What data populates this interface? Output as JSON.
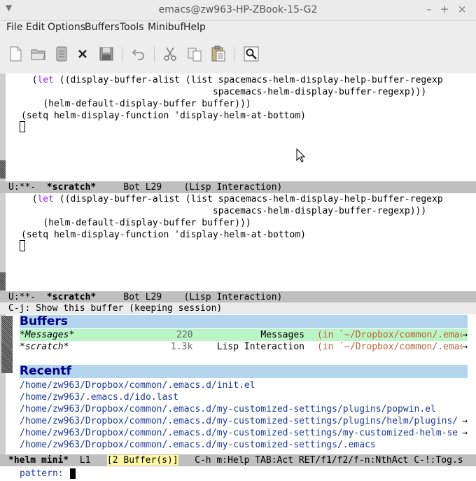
{
  "window": {
    "title": "emacs@zw963-HP-ZBook-15-G2",
    "buttons": [
      "–",
      "+",
      "×"
    ]
  },
  "menubar": {
    "items": [
      "File",
      "Edit",
      "Options",
      "Buffers",
      "Tools",
      "Minibuf",
      "Help"
    ]
  },
  "toolbar": {
    "icons": [
      "new-file-icon",
      "open-folder-icon",
      "dired-icon",
      "close-icon",
      "save-icon",
      "undo-icon",
      "cut-icon",
      "copy-icon",
      "paste-icon",
      "search-icon"
    ]
  },
  "upper_window": {
    "lines": [
      {
        "pre": "  (",
        "kw": "let",
        "post": " ((display-buffer-alist (list spacemacs-helm-display-help-buffer-regexp"
      },
      {
        "pre": "                                   spacemacs-helm-display-buffer-regexp)))",
        "kw": "",
        "post": ""
      },
      {
        "pre": "    (helm-default-display-buffer buffer)))",
        "kw": "",
        "post": ""
      },
      {
        "pre": "(setq helm-display-function 'display-helm-at-bottom)",
        "kw": "",
        "post": ""
      }
    ],
    "modeline": {
      "status": "U:**-",
      "buffer": "*scratch*",
      "position": "Bot L29",
      "mode": "(Lisp Interaction)"
    }
  },
  "lower_window": {
    "lines": [
      {
        "pre": "  (",
        "kw": "let",
        "post": " ((display-buffer-alist (list spacemacs-helm-display-help-buffer-regexp"
      },
      {
        "pre": "                                   spacemacs-helm-display-buffer-regexp)))",
        "kw": "",
        "post": ""
      },
      {
        "pre": "    (helm-default-display-buffer buffer)))",
        "kw": "",
        "post": ""
      },
      {
        "pre": "(setq helm-display-function 'display-helm-at-bottom)",
        "kw": "",
        "post": ""
      }
    ],
    "modeline": {
      "status": "U:**-",
      "buffer": "*scratch*",
      "position": "Bot L29",
      "mode": "(Lisp Interaction)"
    }
  },
  "echo_area": "C-j: Show this buffer (keeping session)",
  "helm": {
    "buffers_header": "Buffers",
    "buffers": [
      {
        "name": "*Messages*",
        "size": "220",
        "mode": "Messages",
        "path": "(in `~/Dropbox/common/.emac",
        "selected": true
      },
      {
        "name": "*scratch*",
        "size": "1.3k",
        "mode": "Lisp Interaction",
        "path": "(in `~/Dropbox/common/.emac",
        "selected": false
      }
    ],
    "recentf_header": "Recentf",
    "recentf": [
      {
        "path": "/home/zw963/Dropbox/common/.emacs.d/init.el",
        "truncated": false
      },
      {
        "path": "/home/zw963/.emacs.d/ido.last",
        "truncated": false
      },
      {
        "path": "/home/zw963/Dropbox/common/.emacs.d/my-customized-settings/plugins/popwin.el",
        "truncated": false
      },
      {
        "path": "/home/zw963/Dropbox/common/.emacs.d/my-customized-settings/plugins/helm/plugins/",
        "truncated": true
      },
      {
        "path": "/home/zw963/Dropbox/common/.emacs.d/my-customized-settings/my-customized-helm-se",
        "truncated": true
      },
      {
        "path": "/home/zw963/Dropbox/common/.emacs.d/my-customized-settings/.emacs",
        "truncated": false
      }
    ],
    "modeline": {
      "name": "*helm mini*",
      "line": "L1",
      "count": "[2 Buffer(s)]",
      "help": "C-h m:Help TAB:Act RET/f1/f2/f-n:NthAct C-!:Tog.s"
    },
    "prompt": "pattern:"
  },
  "truncation_glyph": "→"
}
